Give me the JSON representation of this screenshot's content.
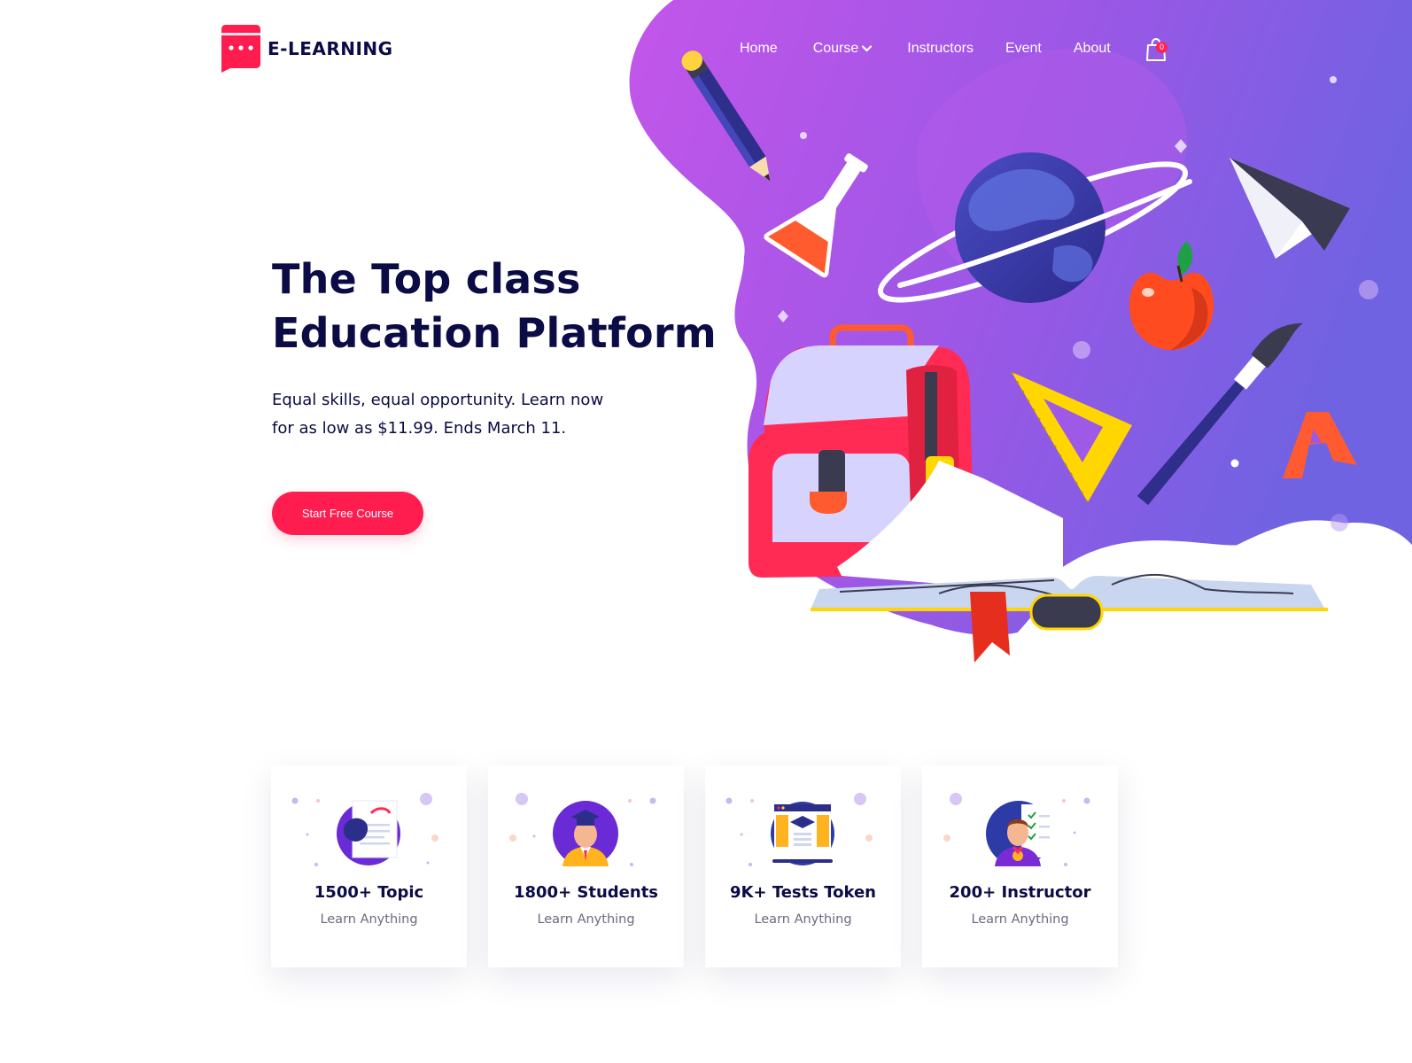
{
  "brand": {
    "name": "E-LEARNING",
    "icon": "chat-bubble-logo-icon",
    "color": "#ff1c4f"
  },
  "nav": {
    "items": [
      {
        "label": "Home"
      },
      {
        "label": "Course",
        "icon": "chevron-down-icon"
      },
      {
        "label": "Instructors"
      },
      {
        "label": "Event"
      },
      {
        "label": "About"
      }
    ],
    "cart": {
      "icon": "shopping-bag-icon",
      "count": "0"
    }
  },
  "hero": {
    "title_line1": "The Top class",
    "title_line2": "Education Platform",
    "subtitle_line1": "Equal skills, equal opportunity. Learn now",
    "subtitle_line2": "for as low as $11.99. Ends March 11.",
    "cta_label": "Start Free Course",
    "gradient_colors": [
      "#c254e8",
      "#7a5ee3"
    ]
  },
  "stats": [
    {
      "number": "1500+ Topic",
      "caption": "Learn Anything",
      "icon": "document-topic-icon"
    },
    {
      "number": "1800+ Students",
      "caption": "Learn Anything",
      "icon": "graduate-student-icon"
    },
    {
      "number": "9K+ Tests Token",
      "caption": "Learn Anything",
      "icon": "online-test-icon"
    },
    {
      "number": "200+ Instructor",
      "caption": "Learn Anything",
      "icon": "instructor-icon"
    }
  ]
}
